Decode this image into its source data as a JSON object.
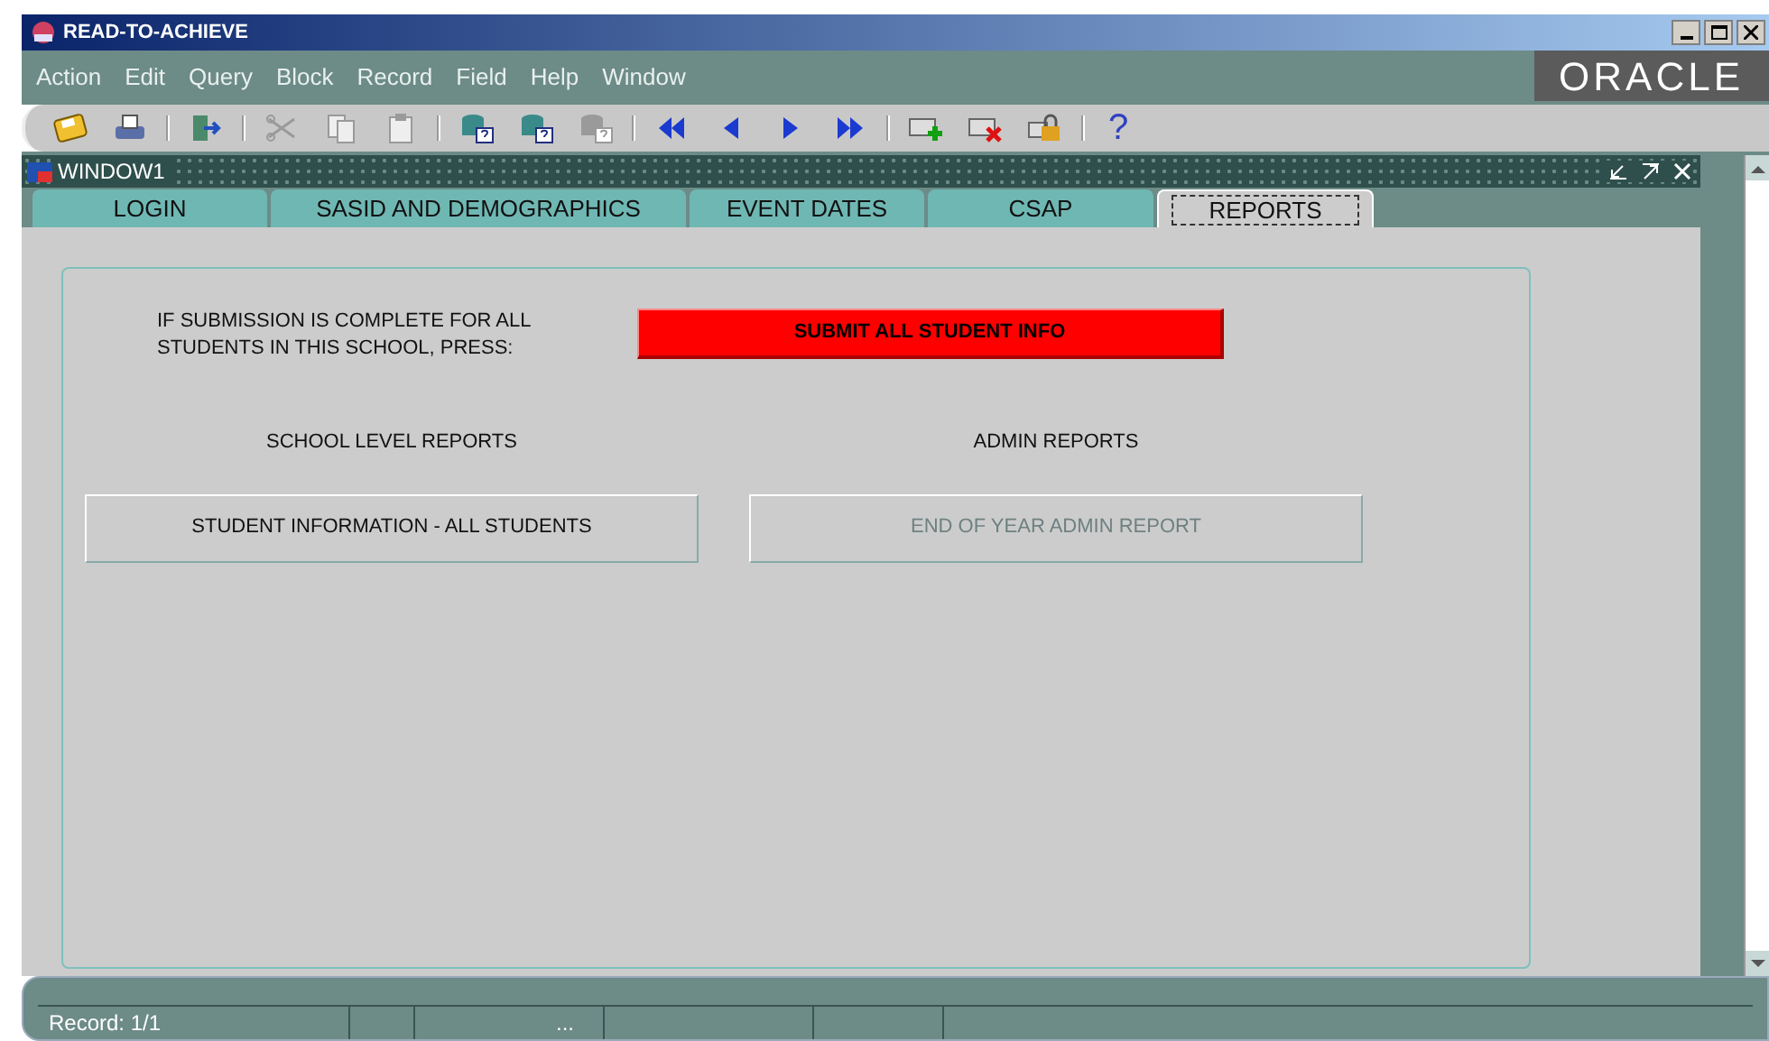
{
  "window": {
    "title": "READ-TO-ACHIEVE"
  },
  "menu": [
    "Action",
    "Edit",
    "Query",
    "Block",
    "Record",
    "Field",
    "Help",
    "Window"
  ],
  "logo": "ORACLE",
  "toolbar": [
    {
      "kind": "save",
      "disabled": false
    },
    {
      "kind": "print",
      "disabled": false
    },
    {
      "kind": "separator"
    },
    {
      "kind": "exit",
      "disabled": false
    },
    {
      "kind": "separator"
    },
    {
      "kind": "cut",
      "disabled": true
    },
    {
      "kind": "copy",
      "disabled": true
    },
    {
      "kind": "paste",
      "disabled": true
    },
    {
      "kind": "separator"
    },
    {
      "kind": "query",
      "disabled": false
    },
    {
      "kind": "query-run",
      "disabled": false
    },
    {
      "kind": "query-cancel",
      "disabled": true
    },
    {
      "kind": "separator"
    },
    {
      "kind": "first",
      "disabled": false
    },
    {
      "kind": "prev",
      "disabled": false
    },
    {
      "kind": "next",
      "disabled": false
    },
    {
      "kind": "last",
      "disabled": false
    },
    {
      "kind": "separator"
    },
    {
      "kind": "insert",
      "disabled": false
    },
    {
      "kind": "delete",
      "disabled": false
    },
    {
      "kind": "lock",
      "disabled": false
    },
    {
      "kind": "separator"
    },
    {
      "kind": "help",
      "label": "?",
      "disabled": false
    }
  ],
  "inner_window": {
    "title": "WINDOW1"
  },
  "tabs": [
    {
      "label": "LOGIN",
      "selected": false
    },
    {
      "label": "SASID AND DEMOGRAPHICS",
      "selected": false
    },
    {
      "label": "EVENT DATES",
      "selected": false
    },
    {
      "label": "CSAP",
      "selected": false
    },
    {
      "label": "REPORTS",
      "selected": true
    }
  ],
  "submit": {
    "prompt": "IF SUBMISSION IS COMPLETE FOR ALL STUDENTS IN THIS SCHOOL, PRESS:",
    "button": "SUBMIT ALL STUDENT INFO"
  },
  "report_groups": [
    {
      "heading": "SCHOOL LEVEL REPORTS",
      "button": "STUDENT INFORMATION - ALL STUDENTS",
      "disabled": false
    },
    {
      "heading": "ADMIN REPORTS",
      "button": "END OF YEAR ADMIN REPORT",
      "disabled": true
    }
  ],
  "status_bar": {
    "record": "Record: 1/1",
    "indicator": "..."
  }
}
